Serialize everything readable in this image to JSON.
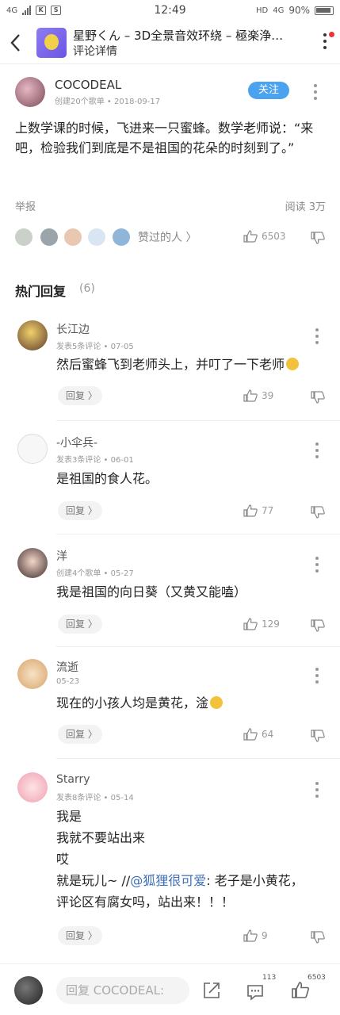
{
  "status_bar": {
    "network": "4G",
    "time": "12:49",
    "hd": "HD",
    "signal2": "4G",
    "battery": "90%"
  },
  "header": {
    "song_title": "星野くん – 3D全景音效环绕 – 極楽浄…",
    "subtitle": "评论详情"
  },
  "main_comment": {
    "author": "COCODEAL",
    "meta": "创建20个歌单 • 2018-09-17",
    "follow_label": "关注",
    "content": "上数学课的时候，飞进来一只蜜蜂。数学老师说：“来吧，检验我们到底是不是祖国的花朵的时刻到了。”",
    "report_label": "举报",
    "reads": "阅读 3万",
    "likers_label": "赞过的人 〉",
    "like_count": "6503"
  },
  "hot_replies": {
    "title": "热门回复",
    "count": "(6)",
    "reply_label": "回复 〉",
    "items": [
      {
        "name": "长江边",
        "meta": "发表5条评论 • 07-05",
        "lines": [
          "然后蜜蜂飞到老师头上，并叮了一下老师"
        ],
        "likes": "39",
        "emoji": true
      },
      {
        "name": "-小伞兵-",
        "meta": "发表3条评论 • 06-01",
        "lines": [
          "是祖国的食人花。"
        ],
        "likes": "77"
      },
      {
        "name": "洋",
        "meta": "创建4个歌单 • 05-27",
        "lines": [
          "我是祖国的向日葵（又黄又能嗑）"
        ],
        "likes": "129"
      },
      {
        "name": "流逝",
        "meta": "05-23",
        "lines": [
          "现在的小孩人均是黄花，淦"
        ],
        "likes": "64",
        "emoji": true
      },
      {
        "name": "Starry",
        "meta": "发表8条评论 • 05-14",
        "lines": [
          "我是",
          "我就不要站出来",
          "哎",
          "就是玩儿~ //",
          "评论区有腐女吗，站出来！！！"
        ],
        "mention": "@狐狸很可爱",
        "mention_after": ": 老子是小黄花，",
        "likes": "9"
      }
    ]
  },
  "bottom_bar": {
    "input_placeholder": "回复 COCODEAL:",
    "comment_count": "113",
    "like_count": "6503"
  }
}
